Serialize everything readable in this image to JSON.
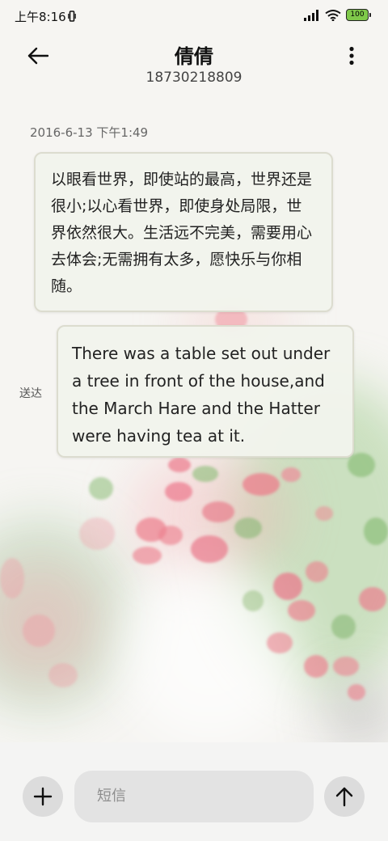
{
  "status_bar": {
    "time": "上午8:16",
    "battery": "100"
  },
  "header": {
    "contact_name": "倩倩",
    "phone_number": "18730218809"
  },
  "conversation": {
    "timestamp": "2016-6-13 下午1:49",
    "received_message": "以眼看世界，即使站的最高，世界还是很小;以心看世界，即使身处局限，世界依然很大。生活远不完美，需要用心去体会;无需拥有太多，愿快乐与你相随。",
    "sent_message": "There was a table set out under a tree in front of the house,and the March Hare and the Hatter were having tea at it.",
    "sent_status": "送达"
  },
  "composer": {
    "placeholder": "短信"
  },
  "icons": {
    "back": "back-arrow-icon",
    "more": "more-vertical-icon",
    "add": "plus-icon",
    "send": "send-arrow-icon",
    "signal": "signal-icon",
    "wifi": "wifi-icon",
    "battery": "battery-icon"
  },
  "colors": {
    "bubble_background": "#f1f4ec",
    "bubble_border": "#dcdccf",
    "button_background": "#dcdcdc",
    "input_background": "#e3e3e3",
    "battery_fill": "#7fc94a"
  }
}
